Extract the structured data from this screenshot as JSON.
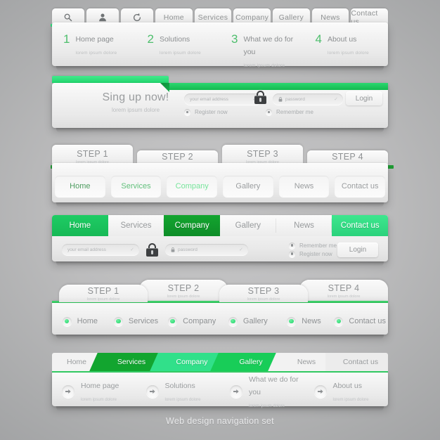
{
  "caption": "Web design navigation set",
  "colors": {
    "green_bright": "#1ecc64",
    "green_dark": "#13a52f",
    "green_mint": "#3ee68e",
    "accent_strip": "#1f9b33"
  },
  "section1": {
    "icon_tabs": [
      {
        "name": "search-icon",
        "label": ""
      },
      {
        "name": "user-icon",
        "label": ""
      },
      {
        "name": "refresh-icon",
        "label": ""
      }
    ],
    "tabs": [
      "Home",
      "Services",
      "Company",
      "Gallery",
      "News",
      "Contact us"
    ],
    "items": [
      {
        "num": "1",
        "title": "Home page",
        "sub": "lorem ipsum dolore"
      },
      {
        "num": "2",
        "title": "Solutions",
        "sub": "lorem ipsum dolore"
      },
      {
        "num": "3",
        "title": "What we do for you",
        "sub": "lorem ipsum dolore"
      },
      {
        "num": "4",
        "title": "About us",
        "sub": "lorem ipsum dolore"
      }
    ]
  },
  "section2": {
    "heading": "Sing up now!",
    "sub": "lorem ipsum dolore",
    "email_placeholder": "your email address",
    "password_placeholder": "password",
    "login_label": "Login",
    "radio_left": "Register now",
    "radio_right": "Remember me"
  },
  "section3": {
    "steps": [
      {
        "title": "STEP 1",
        "sub": "lorem ipsum dolore"
      },
      {
        "title": "STEP 2",
        "sub": "lorem ipsum dolore"
      },
      {
        "title": "STEP 3",
        "sub": "lorem ipsum dolore"
      },
      {
        "title": "STEP 4",
        "sub": "lorem ipsum dolore"
      }
    ],
    "links": [
      {
        "label": "Home",
        "color": "#4e9c60"
      },
      {
        "label": "Services",
        "color": "#62c07c"
      },
      {
        "label": "Company",
        "color": "#77e49b"
      },
      {
        "label": "Gallery",
        "color": "#9a9d9f"
      },
      {
        "label": "News",
        "color": "#9a9d9f"
      },
      {
        "label": "Contact us",
        "color": "#9a9d9f"
      }
    ]
  },
  "section4": {
    "tabs": [
      {
        "label": "Home",
        "state": "active-bright"
      },
      {
        "label": "Services",
        "state": "gray"
      },
      {
        "label": "Company",
        "state": "active-dark"
      },
      {
        "label": "Gallery",
        "state": "gray"
      },
      {
        "label": "News",
        "state": "gray"
      },
      {
        "label": "Contact us",
        "state": "active-mint"
      }
    ],
    "email_placeholder": "your email address",
    "password_placeholder": "password",
    "radio_top": "Remember me",
    "radio_bottom": "Register now",
    "login_label": "Login"
  },
  "section5": {
    "steps": [
      {
        "title": "STEP 1",
        "sub": "lorem ipsum dolore"
      },
      {
        "title": "STEP 2",
        "sub": "lorem ipsum dolore"
      },
      {
        "title": "STEP 3",
        "sub": "lorem ipsum dolore"
      },
      {
        "title": "STEP 4",
        "sub": "lorem ipsum dolore"
      }
    ],
    "links": [
      "Home",
      "Services",
      "Company",
      "Gallery",
      "News",
      "Contact us"
    ]
  },
  "section6": {
    "tabs": [
      {
        "label": "Home",
        "bg": "#f2f2f2",
        "fg": "#9a9d9f"
      },
      {
        "label": "Services",
        "bg": "#12a52f",
        "fg": "#ffffff"
      },
      {
        "label": "Company",
        "bg": "#31e08a",
        "fg": "#ffffff"
      },
      {
        "label": "Gallery",
        "bg": "#18cd58",
        "fg": "#ffffff"
      },
      {
        "label": "News",
        "bg": "#f2f2f2",
        "fg": "#9a9d9f"
      },
      {
        "label": "Contact us",
        "bg": "#ececec",
        "fg": "#9a9d9f"
      }
    ],
    "items": [
      {
        "title": "Home page",
        "sub": "lorem ipsum dolore"
      },
      {
        "title": "Solutions",
        "sub": "lorem ipsum dolore"
      },
      {
        "title": "What we do for you",
        "sub": "lorem ipsum dolore"
      },
      {
        "title": "About us",
        "sub": "lorem ipsum dolore"
      }
    ]
  }
}
